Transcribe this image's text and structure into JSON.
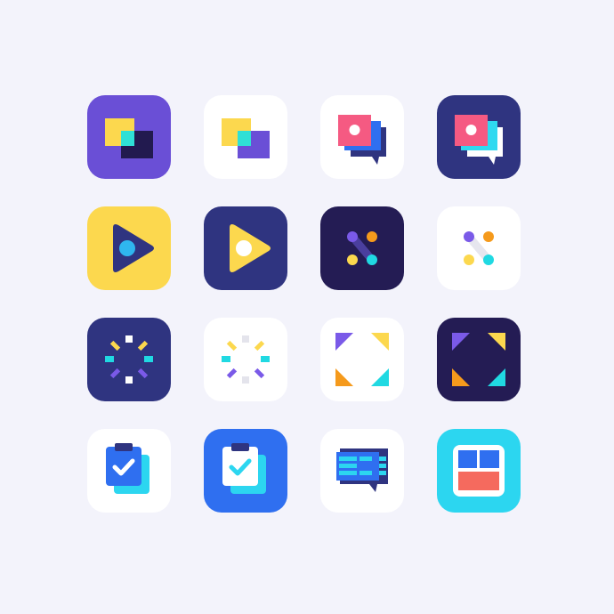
{
  "colors": {
    "page_background": "#f3f3fb",
    "violet": "#6a4fd6",
    "navy": "#2f3480",
    "deep_navy": "#241c54",
    "yellow": "#fcd84e",
    "cyan": "#20d9e2",
    "pink": "#f55a82",
    "blue": "#2f6ff0",
    "sky": "#2cd6f0",
    "orange": "#f59a1c",
    "white": "#ffffff"
  },
  "icons": [
    {
      "name": "overlapping-squares-icon",
      "tile": "violet"
    },
    {
      "name": "overlapping-squares-icon",
      "tile": "white"
    },
    {
      "name": "photo-chat-stack-icon",
      "tile": "white"
    },
    {
      "name": "photo-chat-stack-icon",
      "tile": "navy"
    },
    {
      "name": "play-button-icon",
      "tile": "yellow"
    },
    {
      "name": "play-button-icon",
      "tile": "navy"
    },
    {
      "name": "four-dots-link-icon",
      "tile": "deep_navy"
    },
    {
      "name": "four-dots-link-icon",
      "tile": "white"
    },
    {
      "name": "burst-sparkle-icon",
      "tile": "navy"
    },
    {
      "name": "burst-sparkle-icon",
      "tile": "white"
    },
    {
      "name": "expand-corners-icon",
      "tile": "white"
    },
    {
      "name": "expand-corners-icon",
      "tile": "deep_navy"
    },
    {
      "name": "clipboard-check-icon",
      "tile": "white"
    },
    {
      "name": "clipboard-check-icon",
      "tile": "blue"
    },
    {
      "name": "chat-menu-icon",
      "tile": "white"
    },
    {
      "name": "dashboard-layout-icon",
      "tile": "sky"
    }
  ]
}
